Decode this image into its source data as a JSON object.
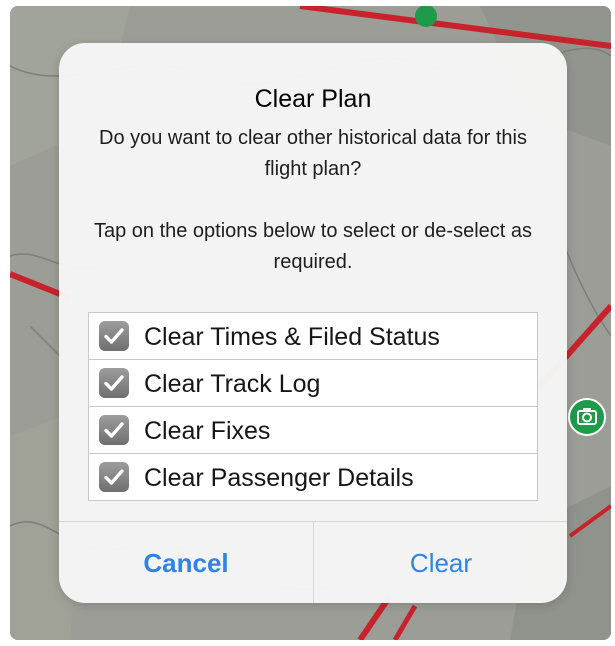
{
  "dialog": {
    "title": "Clear Plan",
    "message_1": "Do you want to clear other historical data for this flight plan?",
    "message_2": "Tap on the options below to select or de-select as required.",
    "options": [
      {
        "label": "Clear Times & Filed Status",
        "checked": true
      },
      {
        "label": "Clear Track Log",
        "checked": true
      },
      {
        "label": "Clear Fixes",
        "checked": true
      },
      {
        "label": "Clear Passenger Details",
        "checked": true
      }
    ],
    "cancel_label": "Cancel",
    "clear_label": "Clear"
  },
  "colors": {
    "accent": "#2f83e4",
    "checkbox": "#8a8a8a",
    "map_route": "#c8232c",
    "map_marker": "#1f9a4a"
  },
  "icons": {
    "checkbox": "checkmark-icon",
    "map_marker": "camera-icon"
  }
}
